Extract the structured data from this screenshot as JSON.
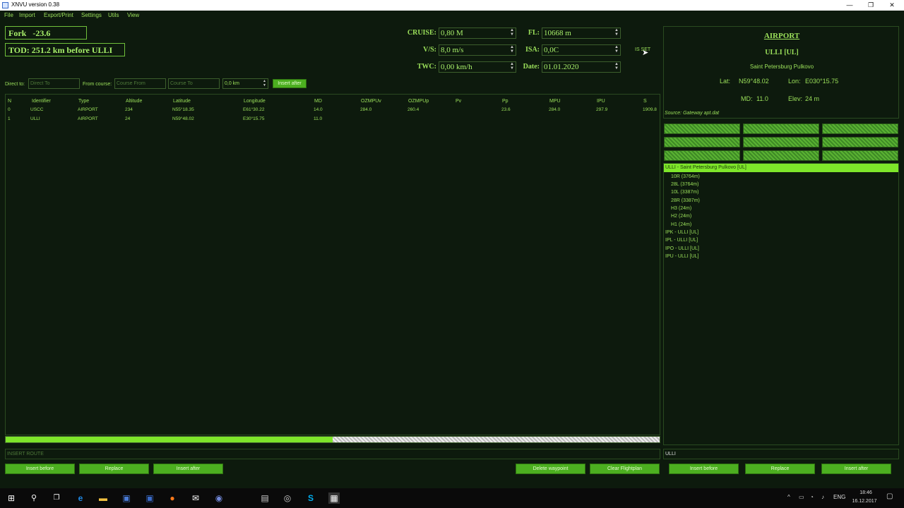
{
  "window": {
    "title": "XNVU version 0.38",
    "min": "—",
    "max": "❐",
    "close": "✕"
  },
  "menu": [
    "File",
    "Import",
    "Export/Print",
    "Settings",
    "Utils",
    "View"
  ],
  "status": {
    "fork_label": "Fork",
    "fork_value": "-23.6",
    "tod": "TOD: 251.2 km before ULLI"
  },
  "params": {
    "cruise_label": "CRUISE:",
    "cruise": "0,80 M",
    "vs_label": "V/S:",
    "vs": "8,0 m/s",
    "twc_label": "TWC:",
    "twc": "0,00 km/h",
    "fl_label": "FL:",
    "fl": "10668 m",
    "isa_label": "ISA:",
    "isa": "0,0C",
    "date_label": "Date:",
    "date": "01.01.2020",
    "is_set": "IS SET"
  },
  "direct": {
    "direct_label": "Direct to:",
    "direct_ph": "Direct To",
    "from_label": "From course:",
    "from_ph": "Course From",
    "to_ph": "Course To",
    "dist": "0,0 km",
    "insert_after": "Insert after"
  },
  "table": {
    "headers": [
      "N",
      "Identifier",
      "Type",
      "Altitude",
      "Latitude",
      "Longitude",
      "MD",
      "OZMPUv",
      "OZMPUp",
      "Pv",
      "Pp",
      "MPU",
      "IPU",
      "S"
    ],
    "rows": [
      [
        "0",
        "USCC",
        "AIRPORT",
        "234",
        "N55°18.35",
        "E61°30.22",
        "14.0",
        "284.0",
        "260.4",
        "",
        "23.6",
        "284.0",
        "297.9",
        "1909.8"
      ],
      [
        "1",
        "ULLI",
        "AIRPORT",
        "24",
        "N59°48.02",
        "E30°15.75",
        "11.0",
        "",
        "",
        "",
        "",
        "",
        "",
        ""
      ]
    ]
  },
  "progress": {
    "fraction": 0.5
  },
  "route": {
    "placeholder": "INSERT ROUTE"
  },
  "bottom_left": {
    "insert_before": "Insert before",
    "replace": "Replace",
    "insert_after": "Insert after"
  },
  "bottom_mid": {
    "delete_wp": "Delete waypoint",
    "clear_fp": "Clear Flightplan"
  },
  "bottom_right": {
    "insert_before": "Insert before",
    "replace": "Replace",
    "insert_after": "Insert after"
  },
  "airport": {
    "heading": "AIRPORT",
    "code": "ULLI [UL]",
    "name": "Saint Petersburg Pulkovo",
    "lat_label": "Lat:",
    "lat": "N59°48.02",
    "lon_label": "Lon:",
    "lon": "E030°15.75",
    "md_label": "MD:",
    "md": "11.0",
    "elev_label": "Elev:",
    "elev": "24 m",
    "source": "Source: Gateway apt.dat"
  },
  "search_results": {
    "selected": "ULLI - Saint Petersburg Pulkovo [UL]",
    "items": [
      "10R (3764m)",
      "28L (3764m)",
      "10L (3387m)",
      "28R (3387m)",
      "H3 (24m)",
      "H2 (24m)",
      "H1 (24m)",
      "IPK - ULLI [UL]",
      "IPL - ULLI [UL]",
      "IPO - ULLI [UL]",
      "IPU - ULLI [UL]"
    ]
  },
  "search": {
    "value": "ULLI"
  },
  "taskbar": {
    "lang": "ENG",
    "time": "18:46",
    "date": "16.12.2017"
  }
}
